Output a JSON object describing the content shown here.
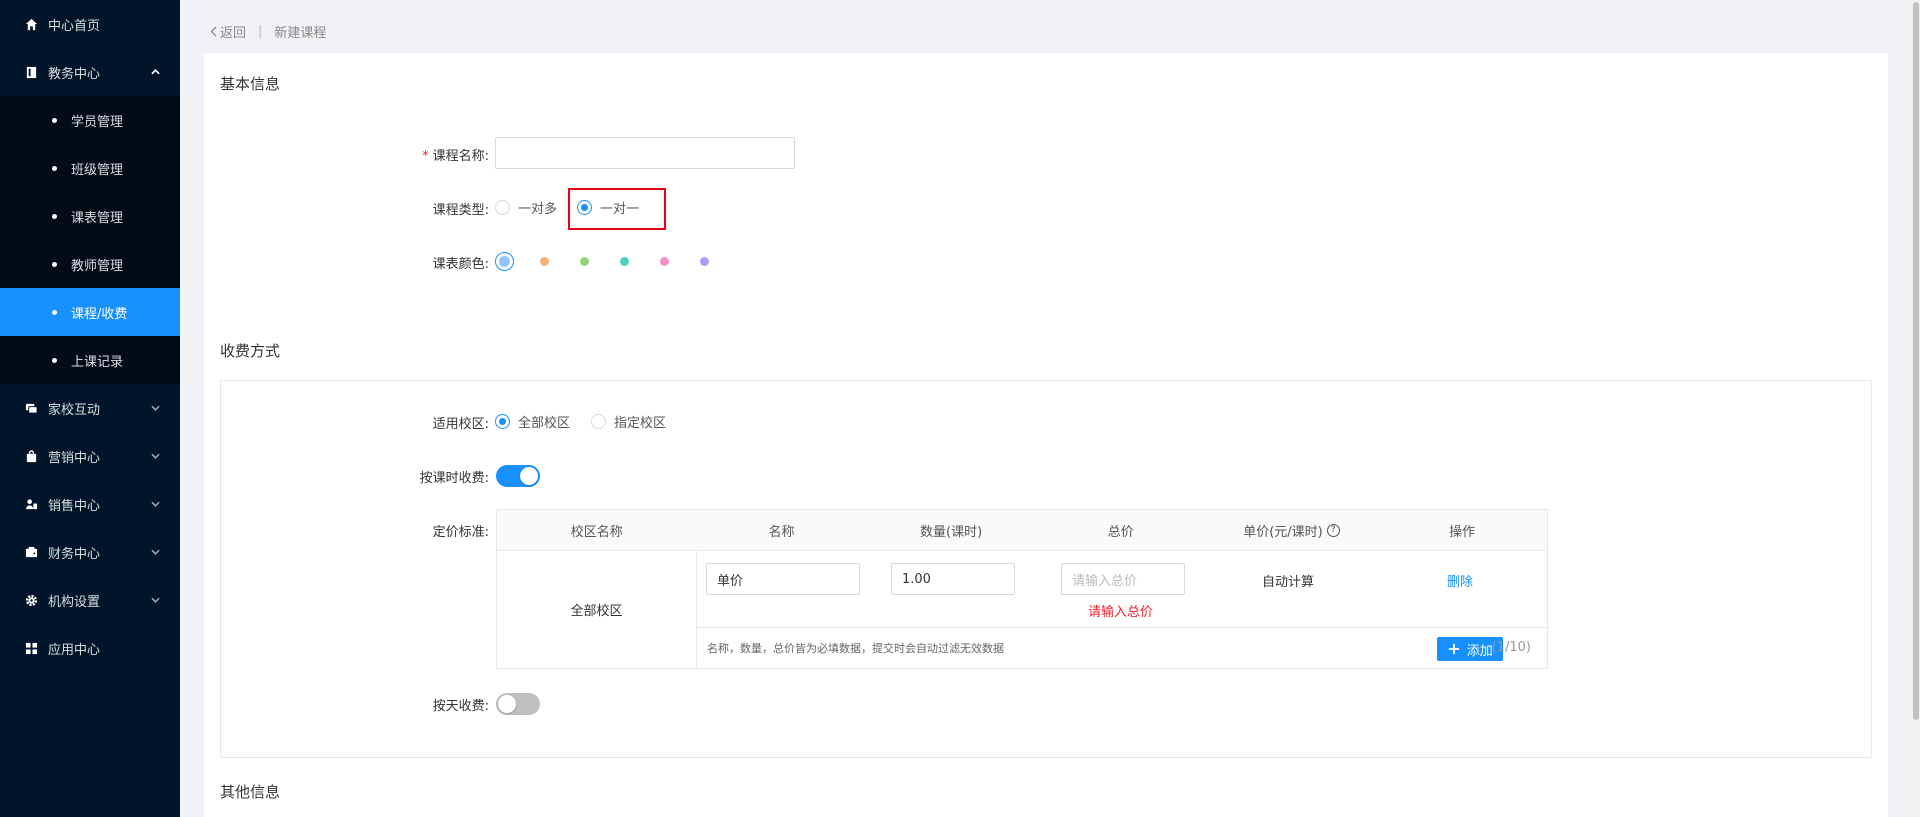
{
  "sidebar": {
    "items": [
      {
        "label": "中心首页",
        "icon": "home-icon"
      },
      {
        "label": "教务中心",
        "icon": "book-icon",
        "expanded": true
      },
      {
        "label": "家校互动",
        "icon": "chat-icon"
      },
      {
        "label": "营销中心",
        "icon": "bag-icon"
      },
      {
        "label": "销售中心",
        "icon": "users-icon"
      },
      {
        "label": "财务中心",
        "icon": "wallet-icon"
      },
      {
        "label": "机构设置",
        "icon": "gear-icon"
      },
      {
        "label": "应用中心",
        "icon": "grid-icon"
      }
    ],
    "sub_items": [
      "学员管理",
      "班级管理",
      "课表管理",
      "教师管理",
      "课程/收费",
      "上课记录"
    ],
    "active_sub": "课程/收费",
    "colors": {
      "bg": "#001529",
      "submenu_bg": "#000c17",
      "active": "#1890ff"
    }
  },
  "breadcrumb": {
    "back": "返回",
    "current": "新建课程"
  },
  "basic": {
    "title": "基本信息",
    "name_label": "课程名称:",
    "name_value": "",
    "type_label": "课程类型:",
    "type_options": [
      "一对多",
      "一对一"
    ],
    "type_selected": "一对一",
    "color_label": "课表颜色:",
    "colors": [
      "#8ec5fc",
      "#f7b27a",
      "#95d475",
      "#4ed0c1",
      "#f58fcb",
      "#b39cf7"
    ]
  },
  "fee": {
    "title": "收费方式",
    "campus_label": "适用校区:",
    "campus_options": [
      "全部校区",
      "指定校区"
    ],
    "campus_selected": "全部校区",
    "by_lesson_label": "按课时收费:",
    "by_lesson_on": true,
    "pricing_label": "定价标准:",
    "table": {
      "headers": [
        "校区名称",
        "名称",
        "数量(课时)",
        "总价",
        "单价(元/课时)",
        "操作"
      ],
      "campus": "全部校区",
      "row": {
        "name": "单价",
        "quantity": "1.00",
        "total_placeholder": "请输入总价",
        "total_error": "请输入总价",
        "unit_price": "自动计算",
        "action": "删除"
      },
      "hint": "名称，数量，总价皆为必填数据，提交时会自动过滤无效数据",
      "add_label": "添加",
      "count": "(1/10)"
    },
    "by_day_label": "按天收费:",
    "by_day_on": false
  },
  "other": {
    "title": "其他信息"
  }
}
